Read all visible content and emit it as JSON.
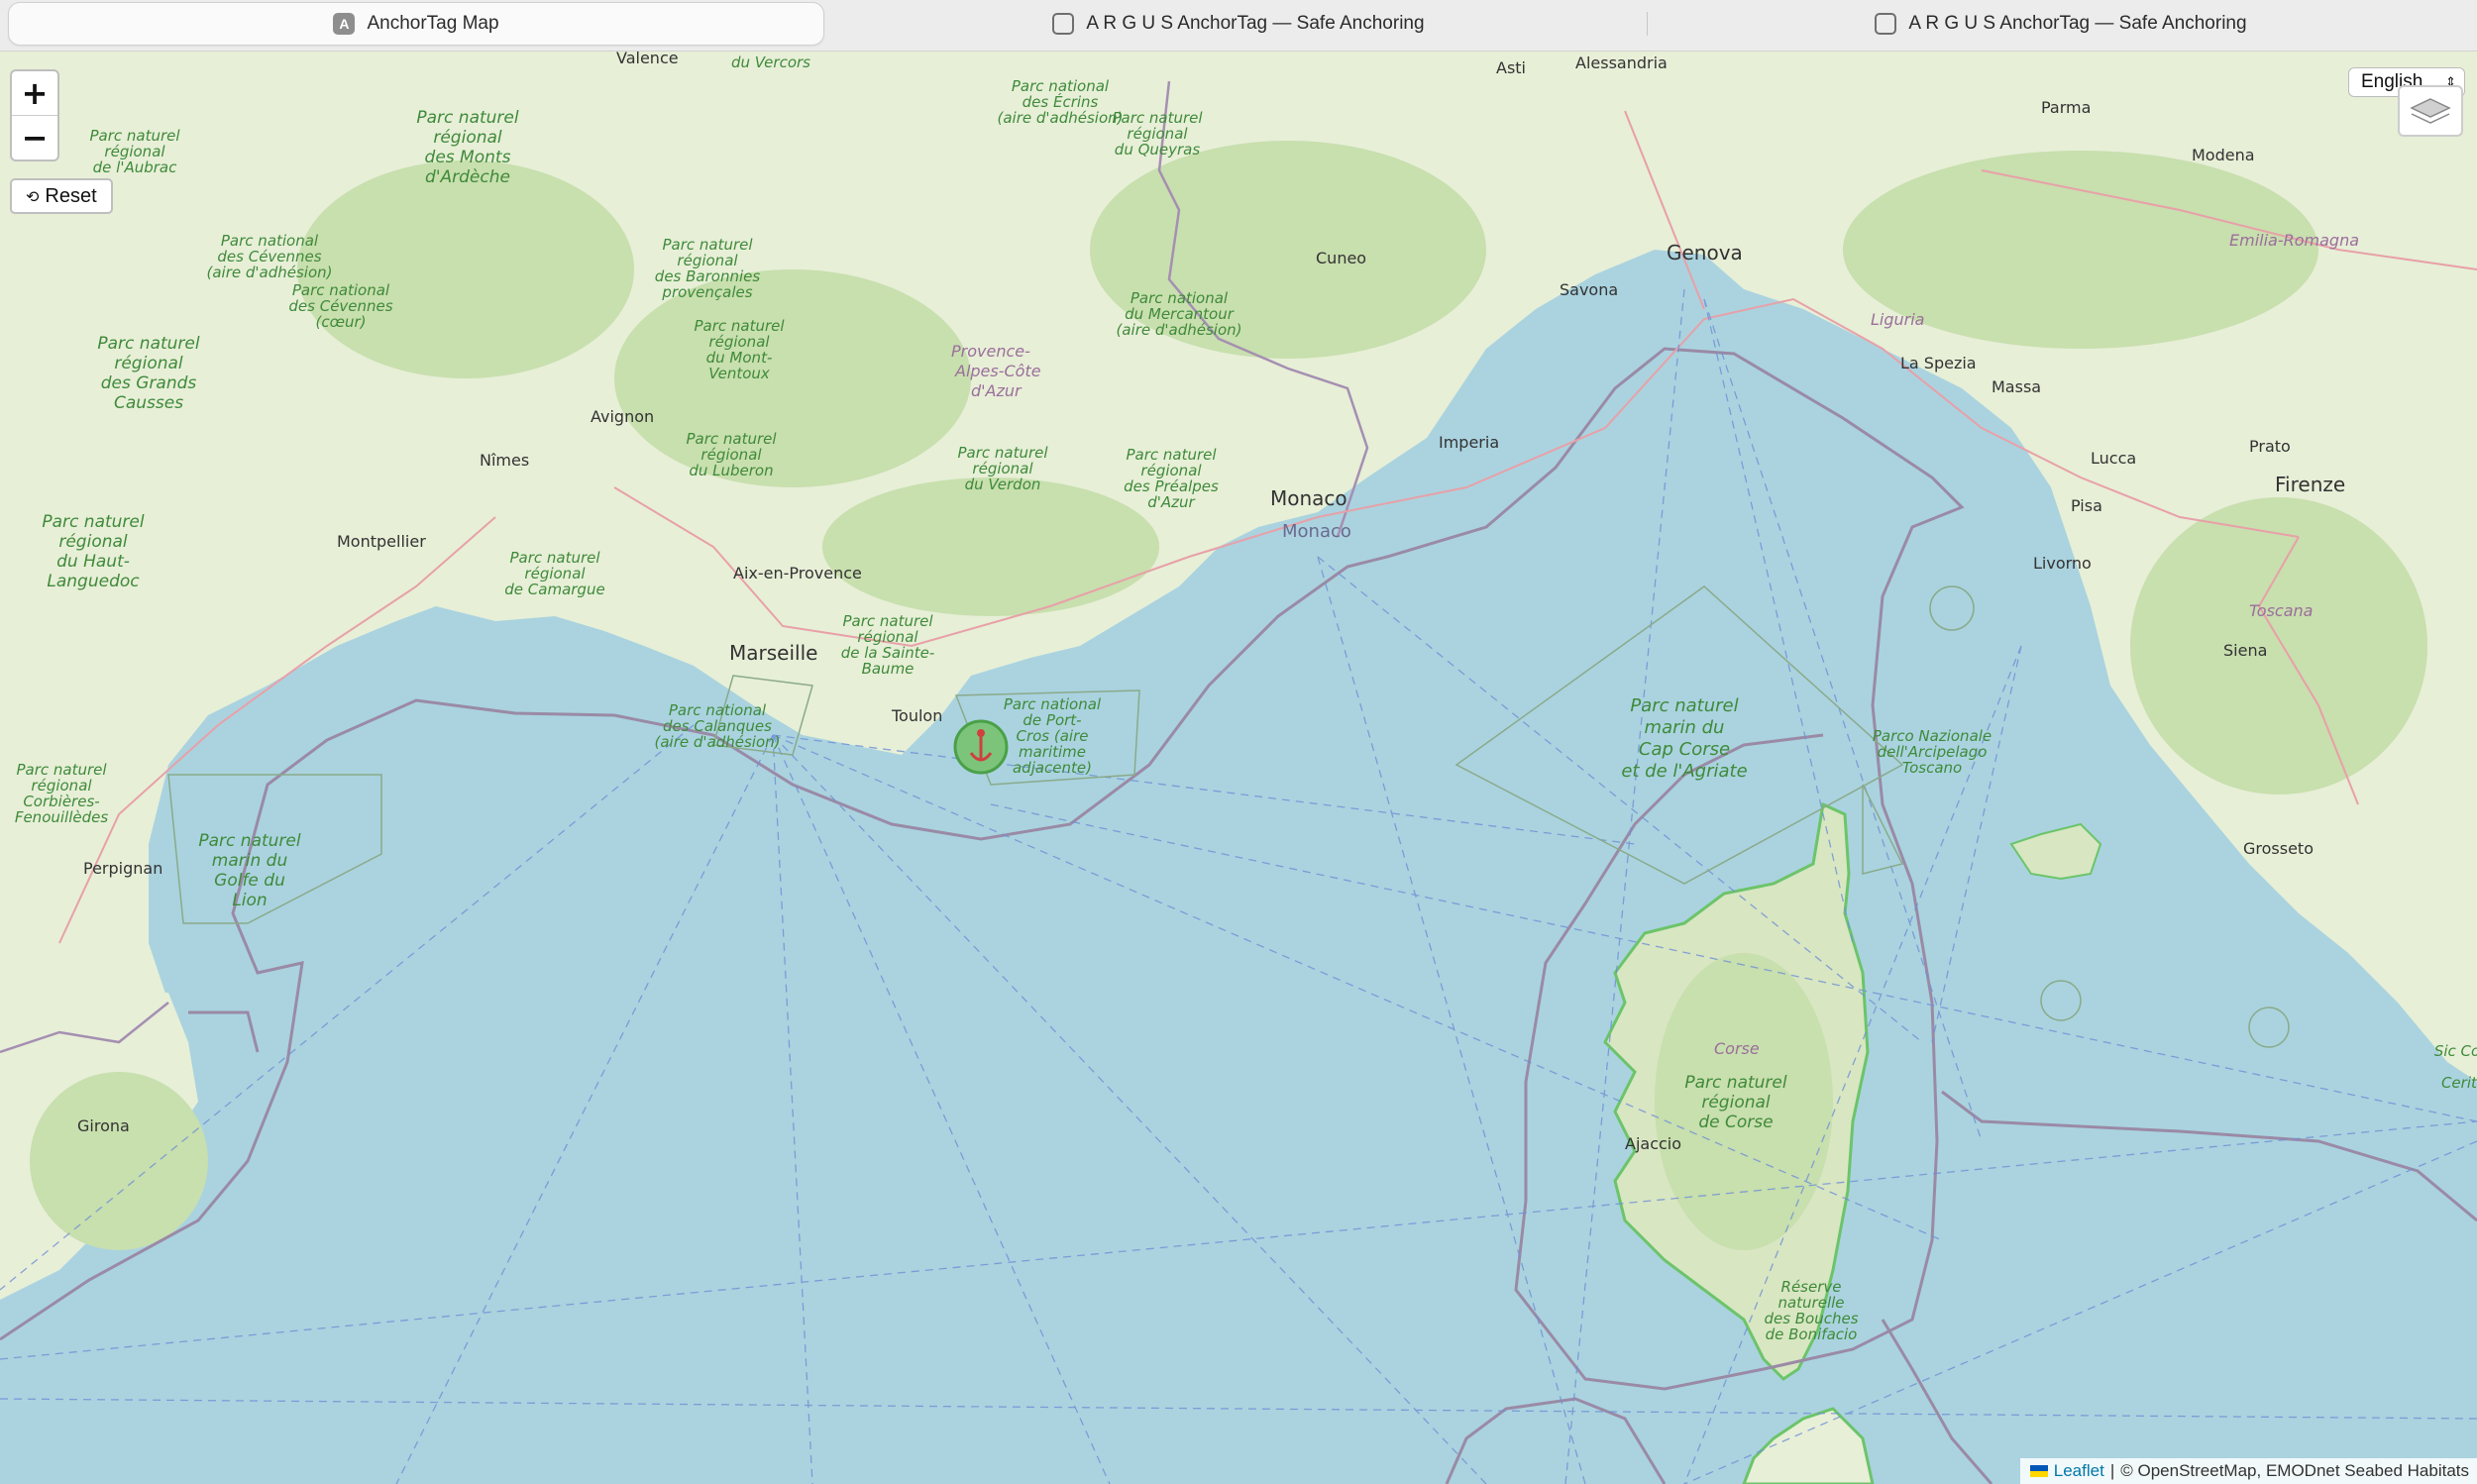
{
  "tabs": [
    {
      "title": "AnchorTag Map",
      "favicon": "A",
      "active": true
    },
    {
      "title": "A R G U S AnchorTag — Safe Anchoring",
      "active": false
    },
    {
      "title": "A R G U S AnchorTag — Safe Anchoring",
      "active": false
    }
  ],
  "controls": {
    "zoom_in": "+",
    "zoom_out": "−",
    "reset_icon": "⟲",
    "reset_label": "Reset",
    "language": "English",
    "layers_icon": "layers-icon"
  },
  "attribution": {
    "leaflet": "Leaflet",
    "separator": "|",
    "text": "© OpenStreetMap, EMODnet Seabed Habitats"
  },
  "colors": {
    "sea": "#aad3df",
    "land": "#e7efd7",
    "forest": "#c8dfae",
    "park_text": "#3f8a3a",
    "border": "#9a8aa6",
    "route": "#6f8fd6"
  },
  "map": {
    "cities": [
      "Valence",
      "Asti",
      "Alessandria",
      "Parma",
      "Modena",
      "Cuneo",
      "Savona",
      "Genova",
      "Avignon",
      "Nîmes",
      "Montpellier",
      "Aix-en-Provence",
      "Marseille",
      "Toulon",
      "Monaco",
      "Imperia",
      "La Spezia",
      "Massa",
      "Lucca",
      "Prato",
      "Firenze",
      "Pisa",
      "Livorno",
      "Siena",
      "Grosseto",
      "Perpignan",
      "Girona",
      "Ajaccio"
    ],
    "regions": [
      "Emilia-Romagna",
      "Liguria",
      "Provence-Alpes-Côte d'Azur",
      "Toscana",
      "Corse"
    ],
    "marine": [
      "Monaco"
    ],
    "parks": [
      "du Vercors",
      "Parc national des Écrins (aire d'adhésion)",
      "Parc naturel régional du Queyras",
      "Parc naturel régional de l'Aubrac",
      "Parc naturel régional des Monts d'Ardèche",
      "Parc national des Cévennes (aire d'adhésion)",
      "Parc national des Cévennes (cœur)",
      "Parc naturel régional des Baronnies provençales",
      "Parc naturel régional du Mont-Ventoux",
      "Parc national du Mercantour (aire d'adhésion)",
      "Parc naturel régional des Grands Causses",
      "Parc naturel régional du Luberon",
      "Parc naturel régional du Verdon",
      "Parc naturel régional des Préalpes d'Azur",
      "Parc naturel régional du Haut-Languedoc",
      "Parc naturel régional de Camargue",
      "Parc naturel régional de la Sainte-Baume",
      "Parc national des Calanques (aire d'adhésion)",
      "Parc national de Port-Cros (aire maritime adjacente)",
      "Parc naturel marin du Cap Corse et de l'Agriate",
      "Parco Nazionale dell'Arcipelago Toscano",
      "Parc naturel régional Corbières-Fenouillèdes",
      "Parc naturel marin du Golfe du Lion",
      "Parc naturel régional de Corse",
      "Réserve naturelle des Bouches de Bonifacio",
      "Sic Co Ceriti"
    ]
  }
}
